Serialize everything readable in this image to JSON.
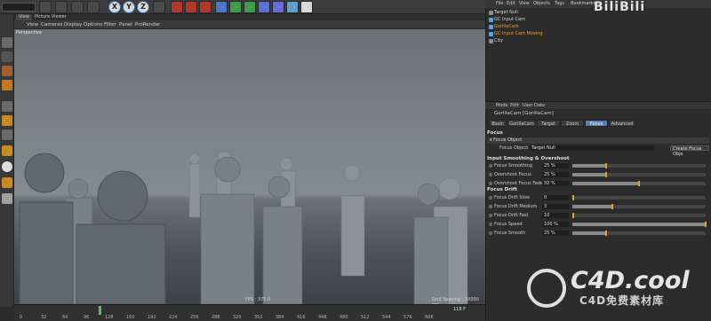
{
  "toolbar": {
    "axes": [
      "X",
      "Y",
      "Z"
    ]
  },
  "viewport": {
    "tabs": [
      "View",
      "Picture Viewer"
    ],
    "menu": [
      "View",
      "Cameras",
      "Display",
      "Options",
      "Filter",
      "Panel",
      "ProRender"
    ],
    "label": "Perspective",
    "fps": "FPS : 375.0",
    "grid_spacing": "Grid Spacing : 10000 cm"
  },
  "timeline": {
    "ticks": [
      "0",
      "32",
      "64",
      "96",
      "128",
      "160",
      "192",
      "224",
      "256",
      "288",
      "320",
      "352",
      "384",
      "416",
      "448",
      "480",
      "512",
      "544",
      "576",
      "608"
    ],
    "current_frame": "118 F"
  },
  "object_manager": {
    "menu": [
      "File",
      "Edit",
      "View",
      "Objects",
      "Tags",
      "Bookmarks"
    ],
    "objects": [
      {
        "name": "Target Null",
        "selected": false
      },
      {
        "name": "GC Input Cam",
        "selected": false
      },
      {
        "name": "GorillaCam",
        "selected": true
      },
      {
        "name": "GC Input Cam Moving",
        "selected": true
      },
      {
        "name": "City",
        "selected": false
      }
    ],
    "logo_text": "BiliBili"
  },
  "attribute_manager": {
    "menu": [
      "Mode",
      "Edit",
      "User Data"
    ],
    "title": "GorillaCam [GorillaCam]",
    "tabs": [
      "Basic",
      "GorillaCam",
      "Target",
      "Zoom",
      "Focus",
      "Advanced"
    ],
    "active_tab": "Focus",
    "focus_section": "Focus",
    "focus_object_group": "▾ Focus Object",
    "focus_object_label": "Focus Object",
    "focus_object_value": "Target Null",
    "create_button": "Create Focus Obje",
    "smoothing_section": "Input Smoothing & Overshoot",
    "smoothing_params": [
      {
        "label": "Focus Smoothing",
        "value": "25 %",
        "fraction": 0.25
      },
      {
        "label": "Overshoot Focus",
        "value": "25 %",
        "fraction": 0.25
      },
      {
        "label": "Overshoot Focus Fade",
        "value": "50 %",
        "fraction": 0.5
      }
    ],
    "drift_section": "Focus Drift",
    "drift_params": [
      {
        "label": "Focus Drift Slow",
        "value": "0",
        "fraction": 0.0
      },
      {
        "label": "Focus Drift Medium",
        "value": "3",
        "fraction": 0.3
      },
      {
        "label": "Focus Drift Fast",
        "value": "10",
        "fraction": 0.0
      },
      {
        "label": "Focus Speed",
        "value": "100 %",
        "fraction": 1.0
      },
      {
        "label": "Focus Smooth",
        "value": "25 %",
        "fraction": 0.25
      }
    ]
  },
  "watermark": {
    "brand": "C4D.cool",
    "subtitle": "C4D免费素材库"
  },
  "colors": {
    "accent": "#e0a32a",
    "active_tab": "#5b7db8",
    "selected_object": "#f0a030"
  }
}
